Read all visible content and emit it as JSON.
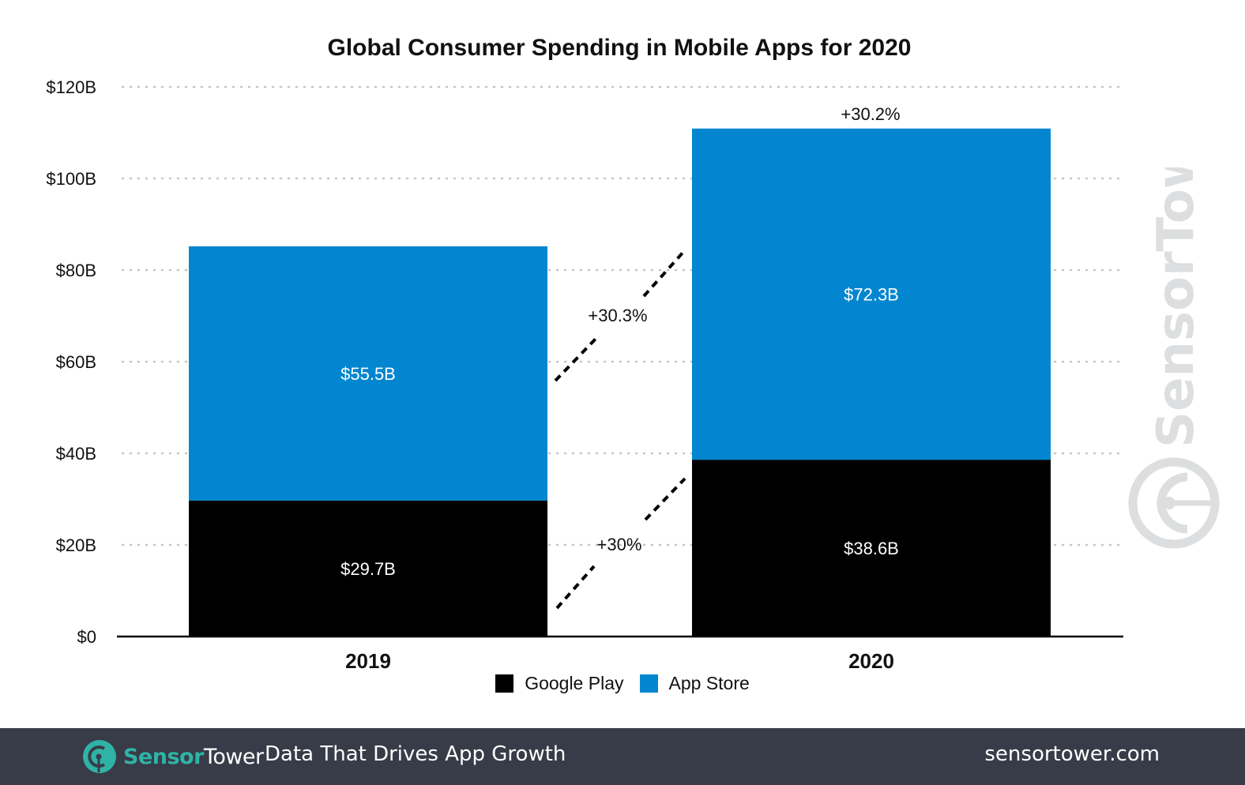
{
  "chart_data": {
    "type": "bar",
    "stacked": true,
    "title": "Global Consumer Spending in Mobile Apps for 2020",
    "xlabel": "",
    "ylabel": "",
    "categories": [
      "2019",
      "2020"
    ],
    "series": [
      {
        "name": "Google Play",
        "color": "#000000",
        "values": [
          29.7,
          38.6
        ],
        "labels": [
          "$29.7B",
          "$38.6B"
        ]
      },
      {
        "name": "App Store",
        "color": "#0286d0",
        "values": [
          55.5,
          72.3
        ],
        "labels": [
          "$55.5B",
          "$72.3B"
        ]
      }
    ],
    "ylim": [
      0,
      120
    ],
    "yticks": [
      0,
      20,
      40,
      60,
      80,
      100,
      120
    ],
    "ytick_labels": [
      "$0",
      "$20B",
      "$40B",
      "$60B",
      "$80B",
      "$100B",
      "$120B"
    ],
    "grid": true,
    "legend_position": "bottom-center",
    "annotations": {
      "google_play_growth": "+30%",
      "app_store_growth": "+30.3%",
      "total_growth": "+30.2%"
    }
  },
  "legend": [
    {
      "label": "Google Play",
      "color": "#000000"
    },
    {
      "label": "App Store",
      "color": "#0286d0"
    }
  ],
  "watermark": {
    "text": "SensorTower",
    "color": "#dcdedf"
  },
  "footer": {
    "brand_part1": "Sensor",
    "brand_part2": "Tower",
    "tagline": "Data That Drives App Growth",
    "website": "sensortower.com",
    "brand_color": "#2fb3a6",
    "background": "#383c48"
  }
}
